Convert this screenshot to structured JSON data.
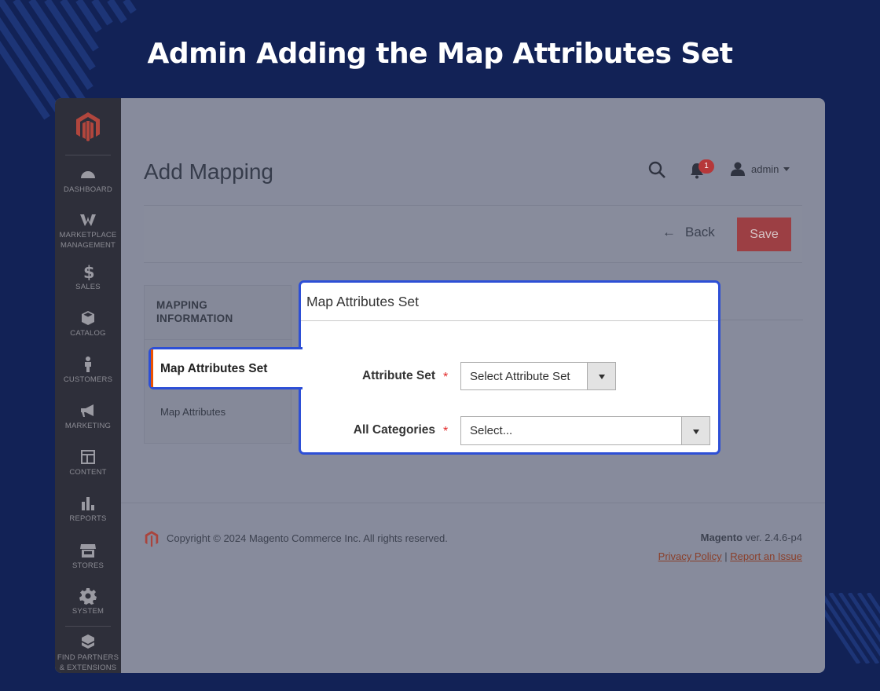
{
  "banner": {
    "title": "Admin Adding the Map Attributes Set"
  },
  "sidebar": {
    "items": [
      {
        "label": "DASHBOARD",
        "icon": "dashboard-icon"
      },
      {
        "label": "MARKETPLACE MANAGEMENT",
        "icon": "marketplace-icon"
      },
      {
        "label": "SALES",
        "icon": "dollar-icon"
      },
      {
        "label": "CATALOG",
        "icon": "box-icon"
      },
      {
        "label": "CUSTOMERS",
        "icon": "person-icon"
      },
      {
        "label": "MARKETING",
        "icon": "megaphone-icon"
      },
      {
        "label": "CONTENT",
        "icon": "layout-icon"
      },
      {
        "label": "REPORTS",
        "icon": "bar-chart-icon"
      },
      {
        "label": "STORES",
        "icon": "store-icon"
      },
      {
        "label": "SYSTEM",
        "icon": "gear-icon"
      },
      {
        "label": "FIND PARTNERS & EXTENSIONS",
        "icon": "cubes-icon"
      }
    ]
  },
  "header": {
    "page_title": "Add Mapping",
    "notifications_count": "1",
    "user_name": "admin"
  },
  "actions": {
    "back_label": "Back",
    "save_label": "Save"
  },
  "tabs": {
    "heading": "MAPPING INFORMATION",
    "items": [
      {
        "label": "Map Attributes Set",
        "active": true
      },
      {
        "label": "Map Attributes",
        "active": false
      }
    ]
  },
  "panel": {
    "title": "Map Attributes Set",
    "fields": [
      {
        "label": "Attribute Set",
        "required_mark": "*",
        "value": "Select Attribute Set"
      },
      {
        "label": "All Categories",
        "required_mark": "*",
        "value": "Select..."
      }
    ]
  },
  "footer": {
    "copyright": "Copyright © 2024 Magento Commerce Inc. All rights reserved.",
    "brand": "Magento",
    "version": "ver. 2.4.6-p4",
    "privacy_label": "Privacy Policy",
    "separator": "|",
    "report_label": "Report an Issue"
  },
  "colors": {
    "background": "#122256",
    "highlight_border": "#2d4fd6",
    "save_button": "#9c3f44",
    "required": "#e22626",
    "brand": "#eb5202"
  }
}
